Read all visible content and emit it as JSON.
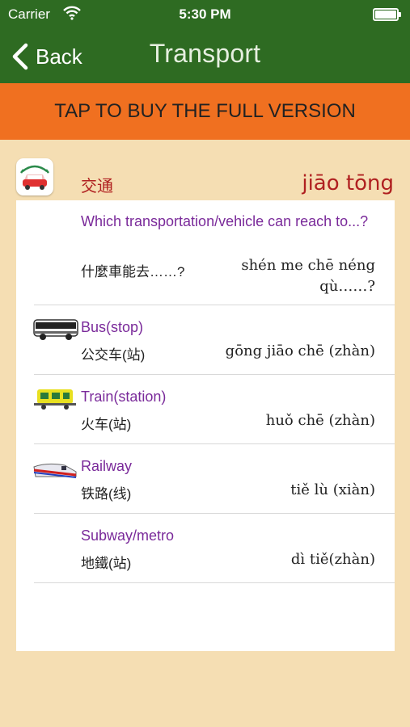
{
  "status": {
    "carrier": "Carrier",
    "time": "5:30 PM"
  },
  "nav": {
    "back_label": "Back",
    "title": "Transport"
  },
  "banner": {
    "label": "TAP TO BUY THE FULL VERSION"
  },
  "category": {
    "chinese": "交通",
    "pinyin": "jiāo tōng",
    "icon": "car-icon"
  },
  "phrases": [
    {
      "english": "Which transportation/vehicle can reach to...?",
      "chinese": "什麼車能去……?",
      "pinyin": "shén me chē néng qù……?",
      "icon": null
    },
    {
      "english": "Bus(stop)",
      "chinese": "公交车(站)",
      "pinyin": "gōng jiāo chē (zhàn)",
      "icon": "bus-icon"
    },
    {
      "english": "Train(station)",
      "chinese": "火车(站)",
      "pinyin": "huǒ chē (zhàn)",
      "icon": "train-icon"
    },
    {
      "english": "Railway",
      "chinese": "铁路(线)",
      "pinyin": "tiě lù (xiàn)",
      "icon": "bullet-train-icon"
    },
    {
      "english": "Subway/metro",
      "chinese": "地鐵(站)",
      "pinyin": "dì tiě(zhàn)",
      "icon": null
    }
  ],
  "colors": {
    "nav": "#2e6b22",
    "banner": "#f07020",
    "background": "#f5deb3",
    "english_text": "#7a2a9a",
    "category_text": "#b02020"
  }
}
